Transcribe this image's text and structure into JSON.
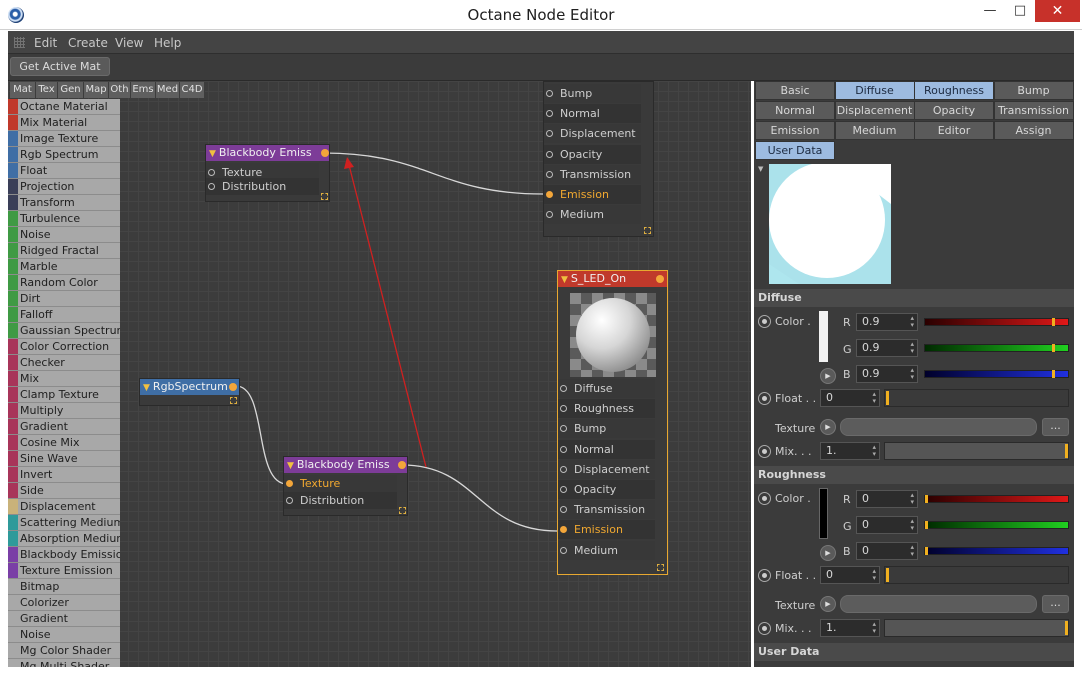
{
  "window": {
    "title": "Octane Node Editor",
    "min": "—",
    "max": "□",
    "close": "✕"
  },
  "menu": [
    "Edit",
    "Create",
    "View",
    "Help"
  ],
  "toolbar": {
    "get_active_mat": "Get Active Mat"
  },
  "category_tabs": [
    "Mat",
    "Tex",
    "Gen",
    "Map",
    "Oth",
    "Ems",
    "Med",
    "C4D"
  ],
  "palette": [
    {
      "label": "Octane Material",
      "color": "#c0392b"
    },
    {
      "label": "Mix Material",
      "color": "#c0392b"
    },
    {
      "label": "Image Texture",
      "color": "#3f6ea5"
    },
    {
      "label": "Rgb Spectrum",
      "color": "#3f6ea5"
    },
    {
      "label": "Float",
      "color": "#3f6ea5"
    },
    {
      "label": "Projection",
      "color": "#3a3f58"
    },
    {
      "label": "Transform",
      "color": "#3a3f58"
    },
    {
      "label": "Turbulence",
      "color": "#3f9a44"
    },
    {
      "label": "Noise",
      "color": "#3f9a44"
    },
    {
      "label": "Ridged Fractal",
      "color": "#3f9a44"
    },
    {
      "label": "Marble",
      "color": "#3f9a44"
    },
    {
      "label": "Random Color",
      "color": "#3f9a44"
    },
    {
      "label": "Dirt",
      "color": "#3f9a44"
    },
    {
      "label": "Falloff",
      "color": "#3f9a44"
    },
    {
      "label": "Gaussian Spectrum",
      "color": "#3f9a44"
    },
    {
      "label": "Color Correction",
      "color": "#a8355a"
    },
    {
      "label": "Checker",
      "color": "#a8355a"
    },
    {
      "label": "Mix",
      "color": "#a8355a"
    },
    {
      "label": "Clamp Texture",
      "color": "#a8355a"
    },
    {
      "label": "Multiply",
      "color": "#a8355a"
    },
    {
      "label": "Gradient",
      "color": "#a8355a"
    },
    {
      "label": "Cosine Mix",
      "color": "#a8355a"
    },
    {
      "label": "Sine Wave",
      "color": "#a8355a"
    },
    {
      "label": "Invert",
      "color": "#a8355a"
    },
    {
      "label": "Side",
      "color": "#a8355a"
    },
    {
      "label": "Displacement",
      "color": "#c9b27a"
    },
    {
      "label": "Scattering Medium",
      "color": "#2f9a9a"
    },
    {
      "label": "Absorption Medium",
      "color": "#2f9a9a"
    },
    {
      "label": "Blackbody Emission",
      "color": "#7a3fa6"
    },
    {
      "label": "Texture Emission",
      "color": "#7a3fa6"
    },
    {
      "label": "Bitmap",
      "color": "#a8a8a8"
    },
    {
      "label": "Colorizer",
      "color": "#a8a8a8"
    },
    {
      "label": "Gradient",
      "color": "#a8a8a8"
    },
    {
      "label": "Noise",
      "color": "#a8a8a8"
    },
    {
      "label": "Mg Color Shader",
      "color": "#a8a8a8"
    },
    {
      "label": "Mg Multi Shader",
      "color": "#a8a8a8"
    }
  ],
  "nodes": {
    "top_material": {
      "pins": [
        "Bump",
        "Normal",
        "Displacement",
        "Opacity",
        "Transmission",
        "Emission",
        "Medium"
      ]
    },
    "blackbody1": {
      "title": "Blackbody Emiss",
      "pins": [
        "Texture",
        "Distribution"
      ]
    },
    "rgb": {
      "title": "RgbSpectrum"
    },
    "blackbody2": {
      "title": "Blackbody Emiss",
      "pins": [
        "Texture",
        "Distribution"
      ]
    },
    "sled": {
      "title": "S_LED_On",
      "pins": [
        "Diffuse",
        "Roughness",
        "Bump",
        "Normal",
        "Displacement",
        "Opacity",
        "Transmission",
        "Emission",
        "Medium"
      ]
    }
  },
  "props": {
    "tabs": [
      "Basic",
      "Diffuse",
      "Roughness",
      "Bump",
      "Normal",
      "Displacement",
      "Opacity",
      "Transmission",
      "Emission",
      "Medium",
      "Editor",
      "Assign",
      "User Data"
    ],
    "active_tabs": [
      "Diffuse",
      "Roughness",
      "User Data"
    ],
    "diffuse": {
      "header": "Diffuse",
      "color_label": "Color .",
      "r_label": "R",
      "g_label": "G",
      "b_label": "B",
      "r": "0.9",
      "g": "0.9",
      "b": "0.9",
      "float_label": "Float . .",
      "float_value": "0",
      "texture_label": "Texture",
      "dots": "...",
      "mix_label": "Mix. . .",
      "mix_value": "1."
    },
    "roughness": {
      "header": "Roughness",
      "color_label": "Color .",
      "r_label": "R",
      "g_label": "G",
      "b_label": "B",
      "r": "0",
      "g": "0",
      "b": "0",
      "float_label": "Float . .",
      "float_value": "0",
      "texture_label": "Texture",
      "dots": "...",
      "mix_label": "Mix. . .",
      "mix_value": "1."
    },
    "user_data_header": "User Data"
  },
  "icons": {
    "triangle": "▼",
    "play": "▶",
    "spin": "▴▾"
  }
}
